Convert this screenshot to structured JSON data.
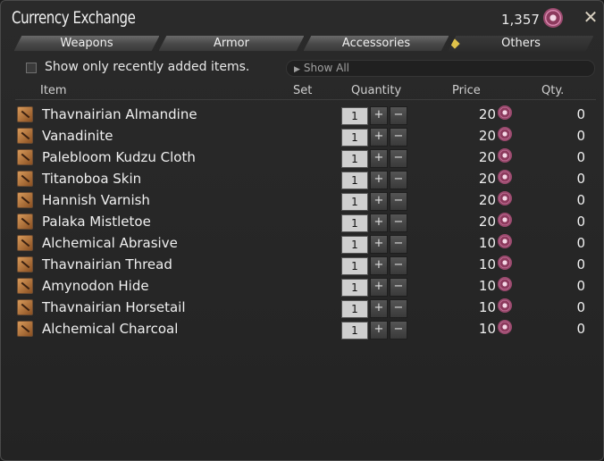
{
  "window": {
    "title": "Currency Exchange",
    "balance": "1,357",
    "balance_icon": "currency-gem-icon",
    "close_icon": "close-icon"
  },
  "tabs": [
    {
      "label": "Weapons",
      "active": false
    },
    {
      "label": "Armor",
      "active": false
    },
    {
      "label": "Accessories",
      "active": false
    },
    {
      "label": "Others",
      "active": true
    }
  ],
  "filter": {
    "checkbox_label": "Show only recently added items.",
    "checkbox_checked": false,
    "dropdown_value": "Show All"
  },
  "columns": {
    "item": "Item",
    "set": "Set",
    "quantity": "Quantity",
    "price": "Price",
    "qty": "Qty."
  },
  "rows": [
    {
      "name": "Thavnairian Almandine",
      "quantity": "1",
      "price": "20",
      "owned": "0"
    },
    {
      "name": "Vanadinite",
      "quantity": "1",
      "price": "20",
      "owned": "0"
    },
    {
      "name": "Palebloom Kudzu Cloth",
      "quantity": "1",
      "price": "20",
      "owned": "0"
    },
    {
      "name": "Titanoboa Skin",
      "quantity": "1",
      "price": "20",
      "owned": "0"
    },
    {
      "name": "Hannish Varnish",
      "quantity": "1",
      "price": "20",
      "owned": "0"
    },
    {
      "name": "Palaka Mistletoe",
      "quantity": "1",
      "price": "20",
      "owned": "0"
    },
    {
      "name": "Alchemical Abrasive",
      "quantity": "1",
      "price": "10",
      "owned": "0"
    },
    {
      "name": "Thavnairian Thread",
      "quantity": "1",
      "price": "10",
      "owned": "0"
    },
    {
      "name": "Amynodon Hide",
      "quantity": "1",
      "price": "10",
      "owned": "0"
    },
    {
      "name": "Thavnairian Horsetail",
      "quantity": "1",
      "price": "10",
      "owned": "0"
    },
    {
      "name": "Alchemical Charcoal",
      "quantity": "1",
      "price": "10",
      "owned": "0"
    }
  ],
  "steppers": {
    "plus": "+",
    "minus": "−"
  }
}
